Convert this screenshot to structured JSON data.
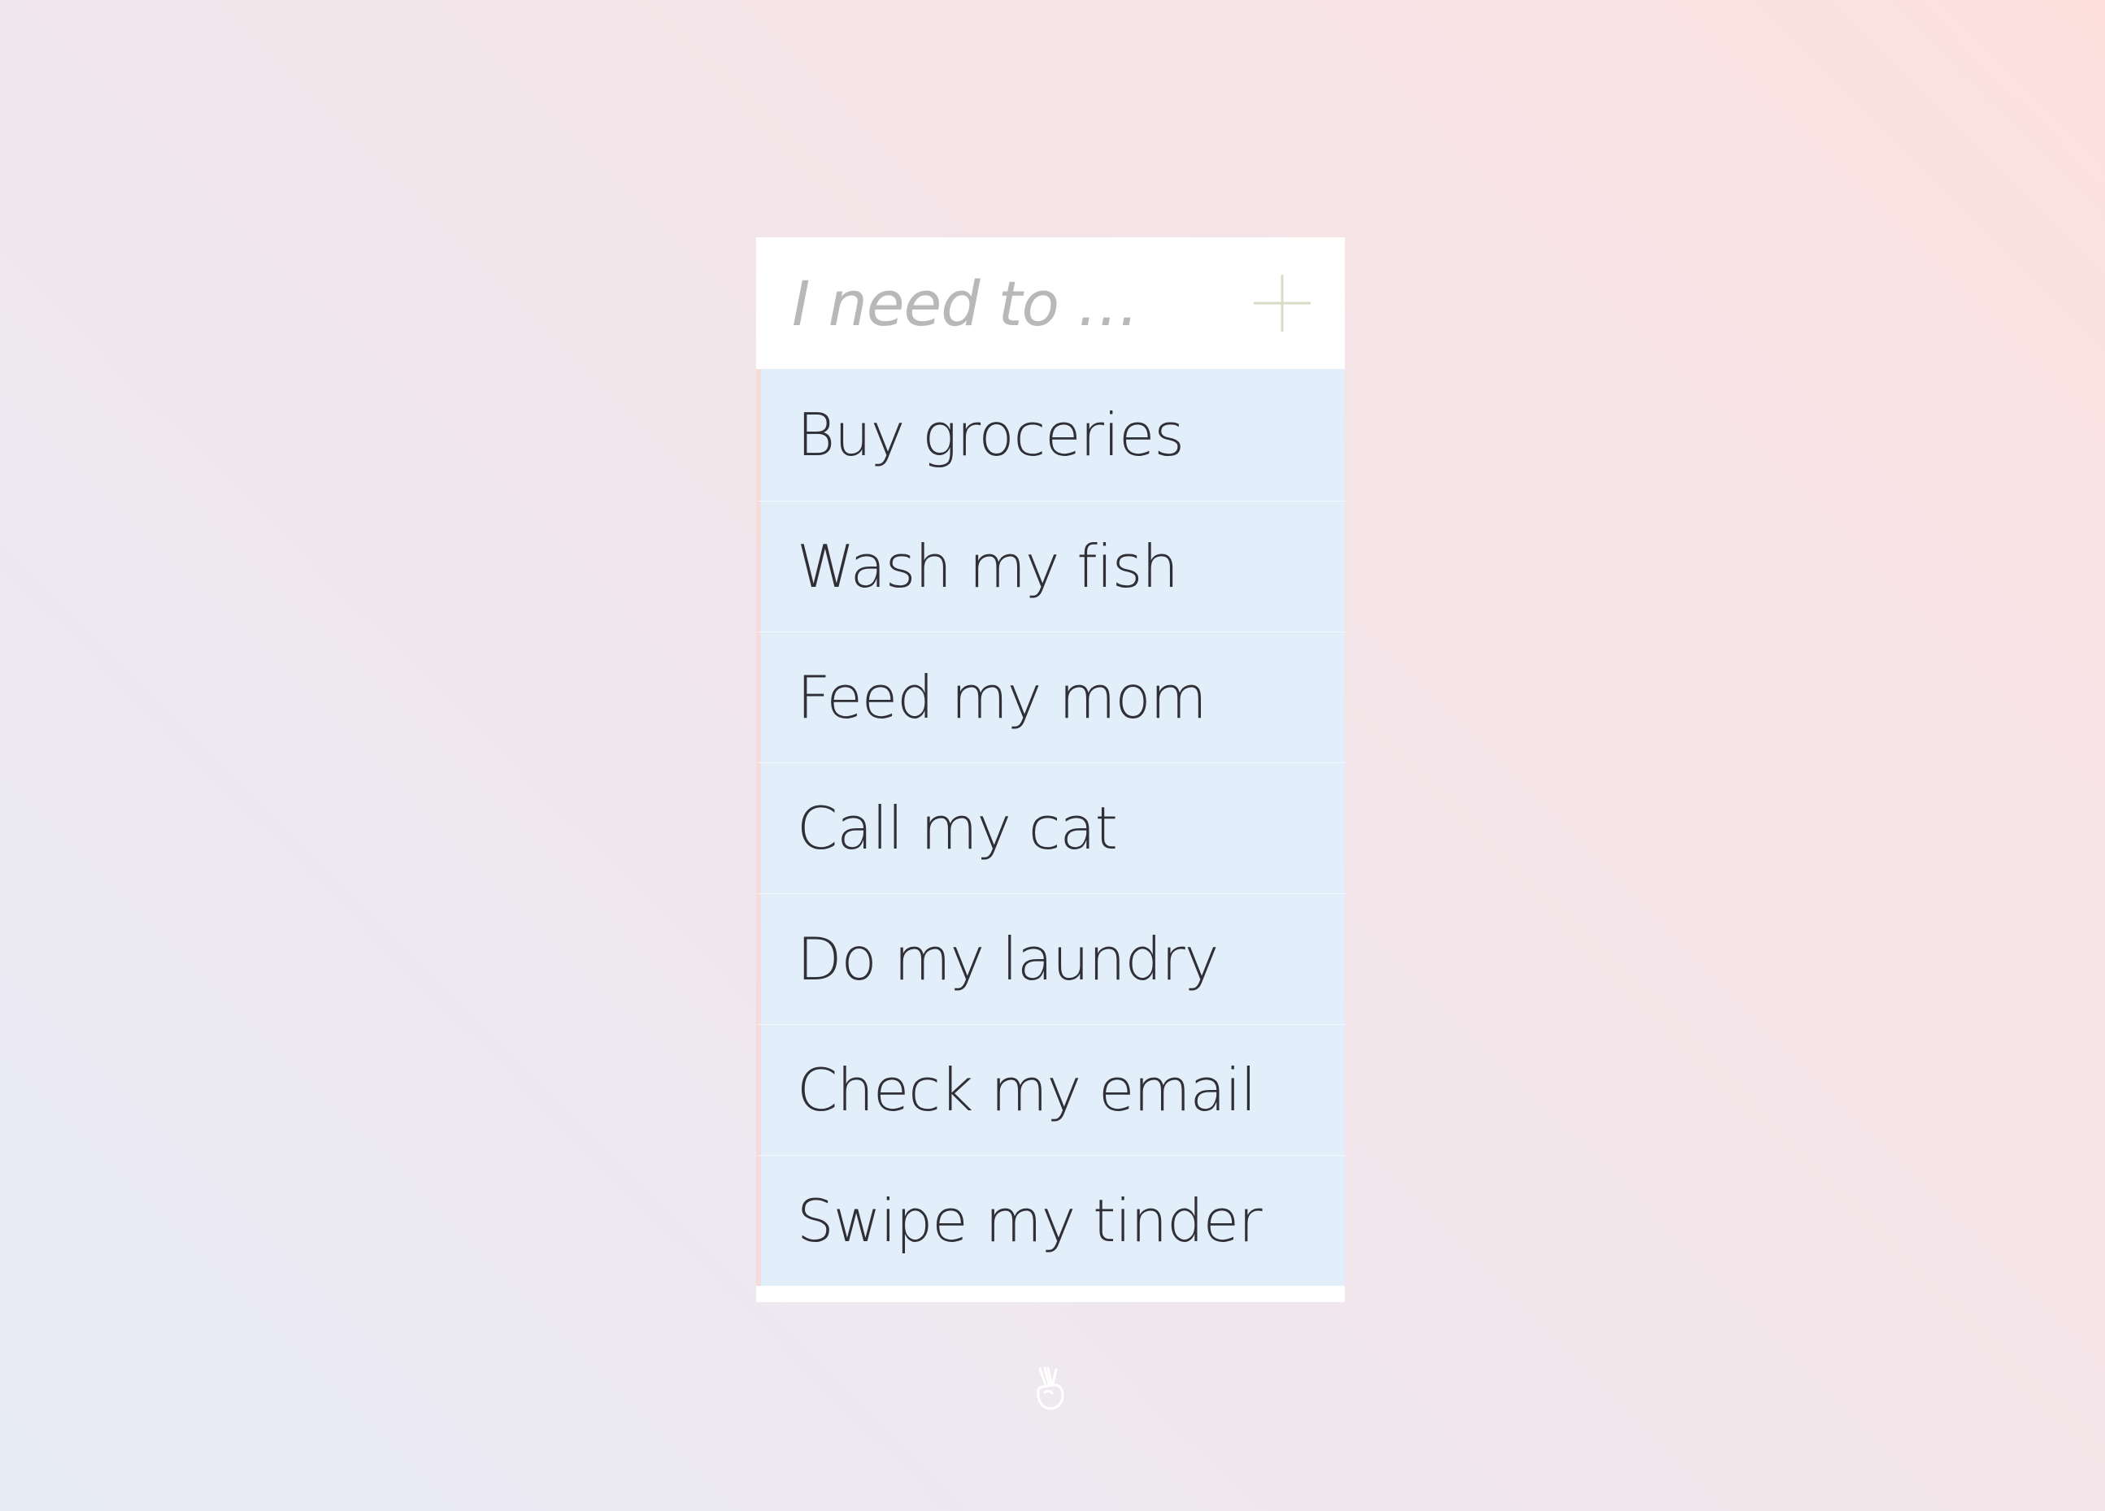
{
  "todo": {
    "input_placeholder": "I need to …",
    "add_icon": "plus-icon",
    "items": [
      {
        "label": "Buy groceries"
      },
      {
        "label": "Wash my fish"
      },
      {
        "label": "Feed my mom"
      },
      {
        "label": "Call my cat"
      },
      {
        "label": "Do my laundry"
      },
      {
        "label": "Check my email"
      },
      {
        "label": "Swipe my tinder"
      }
    ]
  },
  "footer": {
    "icon": "peace-hand-icon"
  },
  "colors": {
    "item_background": "#e2eefa",
    "text": "#2f2f35",
    "placeholder": "#b8b8b8",
    "plus_icon": "#d7dcc4"
  }
}
